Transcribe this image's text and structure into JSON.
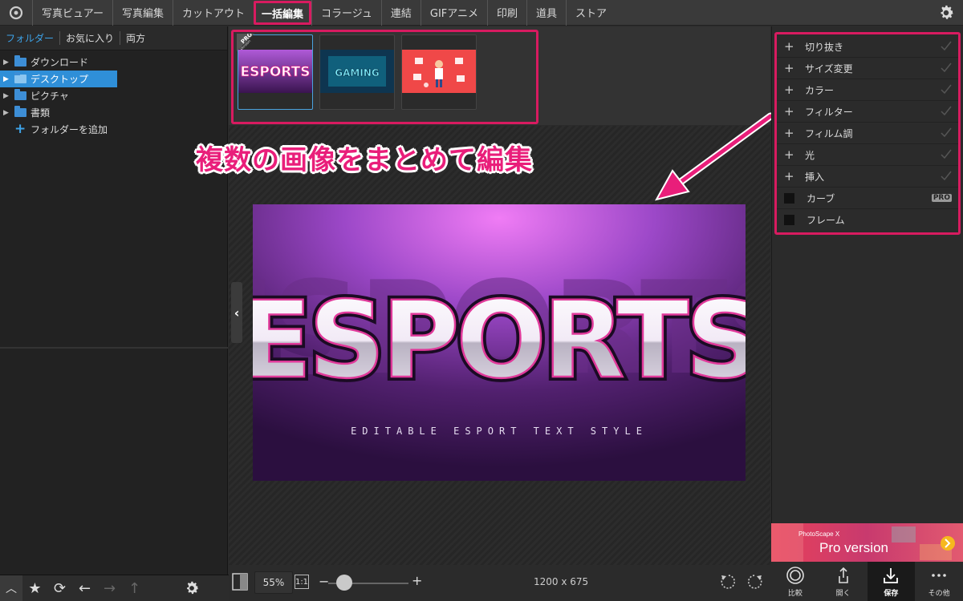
{
  "menu": {
    "items": [
      "写真ビュアー",
      "写真編集",
      "カットアウト",
      "一括編集",
      "コラージュ",
      "連結",
      "GIFアニメ",
      "印刷",
      "道具",
      "ストア"
    ],
    "active_index": 3
  },
  "sidebar": {
    "tabs": [
      "フォルダー",
      "お気に入り",
      "両方"
    ],
    "tree": [
      {
        "label": "ダウンロード"
      },
      {
        "label": "デスクトップ"
      },
      {
        "label": "ピクチャ"
      },
      {
        "label": "書類"
      }
    ],
    "add_folder": "フォルダーを追加"
  },
  "thumbnails": {
    "pro_ribbon": "PRO",
    "pro_ribbon_sub": "Version",
    "items": [
      "ESPORTS",
      "GAMING",
      ""
    ]
  },
  "annotation": "複数の画像をまとめて編集",
  "main_image": {
    "title": "ESPORTS",
    "subtitle": "EDITABLE ESPORT TEXT STYLE"
  },
  "bottom_center": {
    "zoom": "55%",
    "one_to_one": "1:1",
    "minus": "−",
    "plus": "+",
    "zoom_level": 0.2,
    "dimensions": "1200 x 675"
  },
  "right_panel": {
    "items": [
      {
        "label": "切り抜き",
        "kind": "plus"
      },
      {
        "label": "サイズ変更",
        "kind": "plus"
      },
      {
        "label": "カラー",
        "kind": "plus"
      },
      {
        "label": "フィルター",
        "kind": "plus"
      },
      {
        "label": "フィルム調",
        "kind": "plus"
      },
      {
        "label": "光",
        "kind": "plus"
      },
      {
        "label": "挿入",
        "kind": "plus"
      },
      {
        "label": "カーブ",
        "kind": "box",
        "badge": "PRO"
      },
      {
        "label": "フレーム",
        "kind": "box"
      }
    ]
  },
  "ad": {
    "brand": "PhotoScape X",
    "text": "Pro version"
  },
  "bottom_right": {
    "buttons": [
      {
        "label": "比較",
        "icon": "compare-icon"
      },
      {
        "label": "開く",
        "icon": "share-icon"
      },
      {
        "label": "保存",
        "icon": "download-icon"
      },
      {
        "label": "その他",
        "icon": "more-icon"
      }
    ]
  },
  "colors": {
    "highlight": "#d81b60",
    "accent_blue": "#2f8fd8",
    "annotation_pink": "#e91e7a"
  }
}
